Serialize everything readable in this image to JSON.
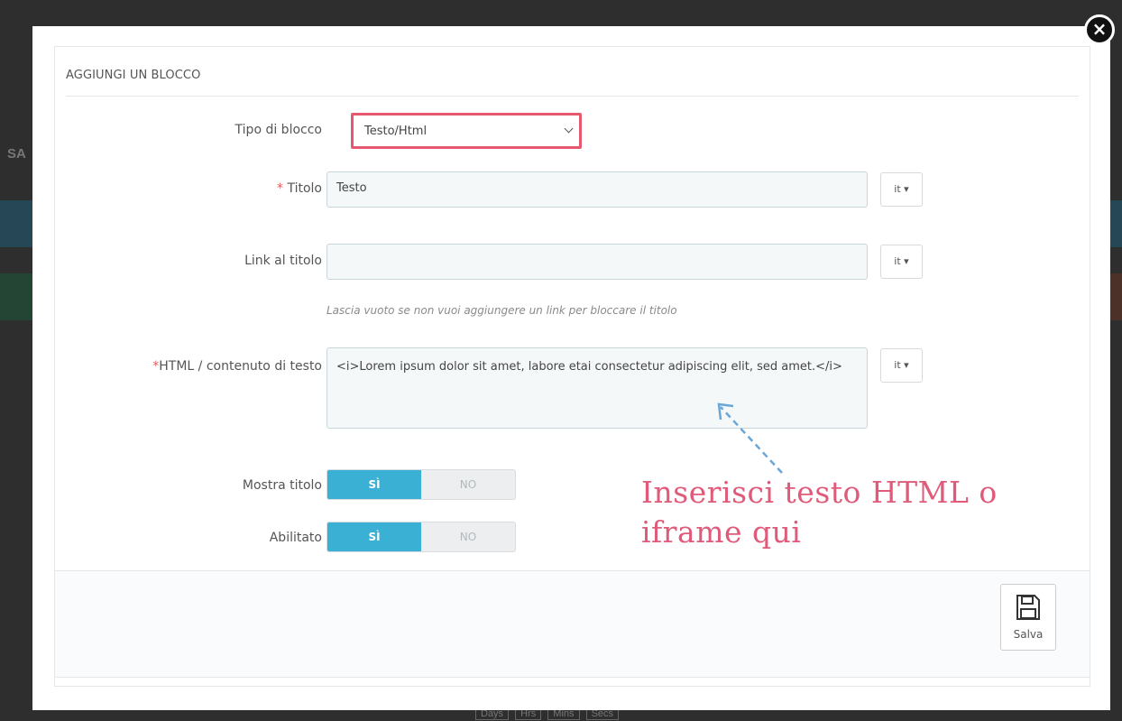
{
  "background": {
    "partial_text": "SA",
    "timer_labels": [
      "Days",
      "Hrs",
      "Mins",
      "Secs"
    ]
  },
  "modal": {
    "close_icon": "×",
    "heading": "AGGIUNGI UN BLOCCO",
    "fields": {
      "block_type": {
        "label": "Tipo di blocco",
        "value": "Testo/Html"
      },
      "title": {
        "label": "Titolo",
        "required_mark": "*",
        "value": "Testo",
        "lang": "it"
      },
      "title_link": {
        "label": "Link al titolo",
        "value": "",
        "lang": "it",
        "help": "Lascia vuoto se non vuoi aggiungere un link per bloccare il titolo"
      },
      "html_content": {
        "label": "HTML / contenuto di testo",
        "required_mark": "*",
        "value": "<i>Lorem ipsum dolor sit amet, labore etai consectetur adipiscing elit, sed amet.</i>",
        "lang": "it"
      },
      "show_title": {
        "label": "Mostra titolo",
        "on": "SÌ",
        "off": "NO"
      },
      "enabled": {
        "label": "Abilitato",
        "on": "SÌ",
        "off": "NO"
      }
    },
    "annotation": "Inserisci testo HTML o iframe qui",
    "save_label": "Salva",
    "colors": {
      "accent": "#3ab0d4",
      "highlight": "#e5586f",
      "annotation": "#e05a7a"
    }
  }
}
